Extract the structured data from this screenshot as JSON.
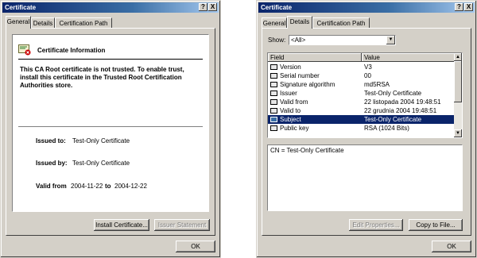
{
  "left": {
    "title": "Certificate",
    "help": "?",
    "close": "X",
    "tabs": [
      "General",
      "Details",
      "Certification Path"
    ],
    "heading": "Certificate Information",
    "message": "This CA Root certificate is not trusted. To enable trust, install this certificate in the Trusted Root Certification Authorities store.",
    "issued_to_label": "Issued to:",
    "issued_to": "Test-Only Certificate",
    "issued_by_label": "Issued by:",
    "issued_by": "Test-Only Certificate",
    "valid_from_label": "Valid from",
    "valid_from": "2004-11-22",
    "valid_to_label": "to",
    "valid_to": "2004-12-22",
    "install_button": "Install Certificate...",
    "issuer_button": "Issuer Statement",
    "ok_button": "OK"
  },
  "right": {
    "title": "Certificate",
    "help": "?",
    "close": "X",
    "tabs": [
      "General",
      "Details",
      "Certification Path"
    ],
    "show_label": "Show:",
    "show_value": "<All>",
    "columns": [
      "Field",
      "Value"
    ],
    "rows": [
      {
        "field": "Version",
        "value": "V3"
      },
      {
        "field": "Serial number",
        "value": "00"
      },
      {
        "field": "Signature algorithm",
        "value": "md5RSA"
      },
      {
        "field": "Issuer",
        "value": "Test-Only Certificate"
      },
      {
        "field": "Valid from",
        "value": "22 listopada 2004 19:48:51"
      },
      {
        "field": "Valid to",
        "value": "22 grudnia 2004 19:48:51"
      },
      {
        "field": "Subject",
        "value": "Test-Only Certificate"
      },
      {
        "field": "Public key",
        "value": "RSA (1024 Bits)"
      }
    ],
    "detail_text": "CN = Test-Only Certificate",
    "edit_button": "Edit Properties...",
    "copy_button": "Copy to File...",
    "ok_button": "OK"
  }
}
